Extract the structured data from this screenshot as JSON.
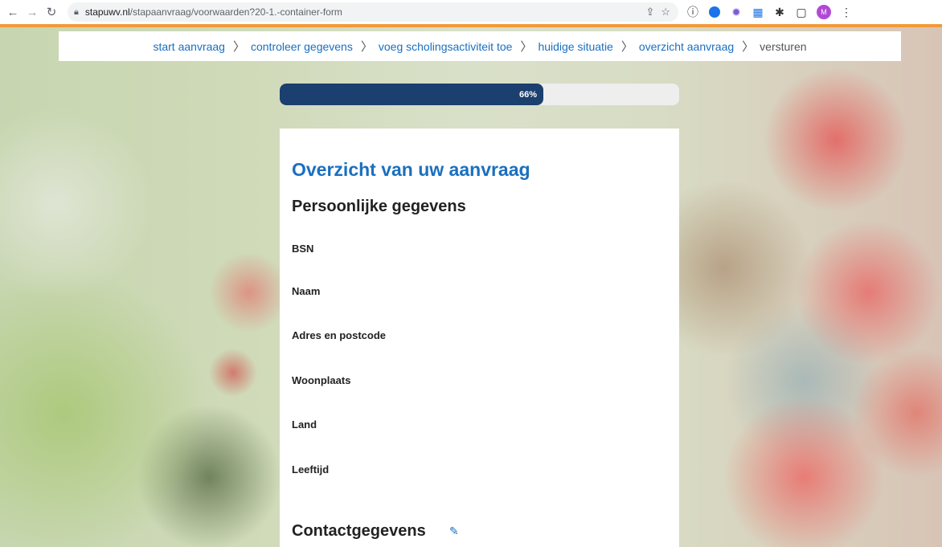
{
  "browser": {
    "url_host": "stapuwv.nl",
    "url_path": "/stapaanvraag/voorwaarden?20-1.-container-form",
    "avatar_letter": "M"
  },
  "breadcrumb": [
    {
      "label": "start aanvraag"
    },
    {
      "label": "controleer gegevens"
    },
    {
      "label": "voeg scholingsactiviteit toe"
    },
    {
      "label": "huidige situatie"
    },
    {
      "label": "overzicht aanvraag"
    },
    {
      "label": "versturen"
    }
  ],
  "progress": {
    "value": 0.66,
    "label": "66%"
  },
  "card": {
    "title": "Overzicht van uw aanvraag",
    "personal_section": "Persoonlijke gegevens",
    "fields": [
      {
        "label": "BSN"
      },
      {
        "label": "Naam"
      },
      {
        "label": "Adres en postcode"
      },
      {
        "label": "Woonplaats"
      },
      {
        "label": "Land"
      },
      {
        "label": "Leeftijd"
      }
    ],
    "contact_section": "Contactgegevens"
  },
  "colors": {
    "link_blue": "#1a6fbf",
    "progress_fill": "#1b3f6e",
    "chrome_accent": "#f29a38"
  }
}
